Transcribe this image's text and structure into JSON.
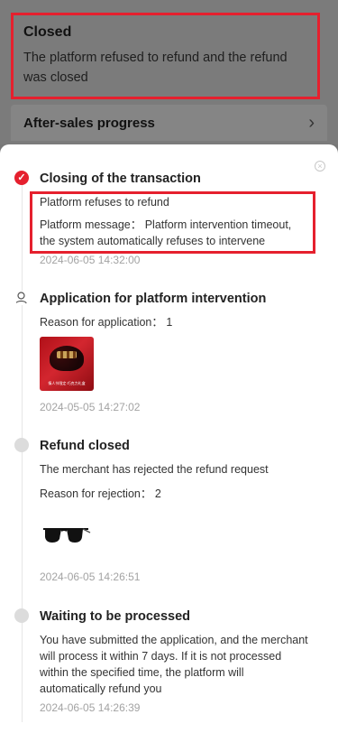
{
  "status": {
    "title": "Closed",
    "description": "The platform refused to refund and the refund was closed"
  },
  "progress": {
    "label": "After-sales progress"
  },
  "timeline": [
    {
      "title": "Closing of the transaction",
      "lines": [
        "Platform refuses to refund",
        "Platform message：  Platform intervention timeout, the system automatically refuses to intervene"
      ],
      "time": "2024-06-05 14:32:00"
    },
    {
      "title": "Application for platform intervention",
      "lines": [
        "Reason for application：  1"
      ],
      "image_caption": "情人节限定·巧克力礼盒",
      "time": "2024-05-05 14:27:02"
    },
    {
      "title": "Refund closed",
      "lines": [
        "The merchant has rejected the refund request",
        "Reason for rejection：  2"
      ],
      "time": "2024-06-05 14:26:51"
    },
    {
      "title": "Waiting to be processed",
      "lines": [
        "You have submitted the application, and the merchant will process it within 7 days. If it is not processed within the specified time, the platform will automatically refund you"
      ],
      "time": "2024-06-05 14:26:39"
    }
  ],
  "icons": {
    "active": "check-circle-icon",
    "user": "user-icon",
    "pending": "grey-dot-icon",
    "close": "close-icon",
    "chevron": "chevron-right-icon"
  },
  "colors": {
    "accent": "#e5202e",
    "muted_time": "#a3a3a3"
  }
}
